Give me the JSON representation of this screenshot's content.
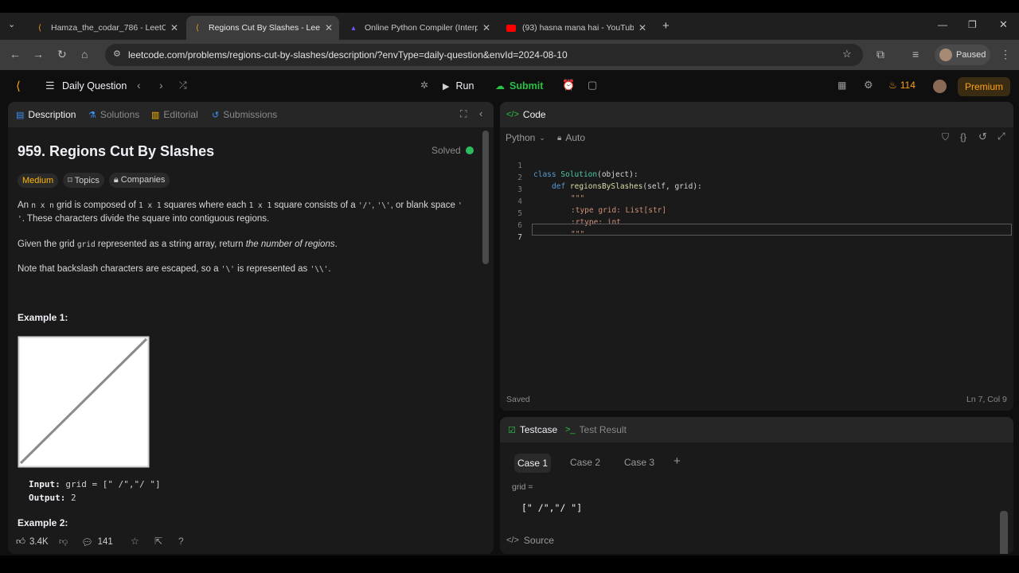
{
  "browser": {
    "tabs": [
      {
        "title": "Hamza_the_codar_786 - LeetCo",
        "icon": "leetcode-icon",
        "active": false
      },
      {
        "title": "Regions Cut By Slashes - LeetC",
        "icon": "leetcode-icon",
        "active": true
      },
      {
        "title": "Online Python Compiler (Interp",
        "icon": "programiz-icon",
        "active": false
      },
      {
        "title": "(93) hasna mana hai - YouTube",
        "icon": "youtube-icon",
        "active": false
      }
    ],
    "url": "leetcode.com/problems/regions-cut-by-slashes/description/?envType=daily-question&envId=2024-08-10",
    "profile_status": "Paused"
  },
  "nav": {
    "daily_question": "Daily Question",
    "run": "Run",
    "submit": "Submit",
    "streak": "114",
    "premium": "Premium"
  },
  "desc_tabs": {
    "description": "Description",
    "solutions": "Solutions",
    "editorial": "Editorial",
    "submissions": "Submissions"
  },
  "problem": {
    "title": "959. Regions Cut By Slashes",
    "status": "Solved",
    "difficulty": "Medium",
    "topics": "Topics",
    "companies": "Companies",
    "p1_a": "An",
    "p1_code1": "n x n",
    "p1_b": "grid is composed of",
    "p1_code2": "1 x 1",
    "p1_c": "squares where each",
    "p1_code3": "1 x 1",
    "p1_d": "square consists of a",
    "p1_code4": "'/'",
    "p1_sep1": ",",
    "p1_code5": "'\\'",
    "p1_e": ", or blank",
    "p1_f": "space",
    "p1_code6": "' '",
    "p1_g": ". These characters divide the square into contiguous regions.",
    "p2_a": "Given the grid",
    "p2_code": "grid",
    "p2_b": "represented as a string array, return",
    "p2_em": "the number of regions",
    "p2_c": ".",
    "p3_a": "Note that backslash characters are escaped, so a",
    "p3_code1": "'\\'",
    "p3_b": "is represented as",
    "p3_code2": "'\\\\'",
    "p3_c": ".",
    "example1": "Example 1:",
    "input_label": "Input:",
    "input_value": "grid = [\" /\",\"/ \"]",
    "output_label": "Output:",
    "output_value": "2",
    "example2": "Example 2:"
  },
  "footer": {
    "likes": "3.4K",
    "comments": "141"
  },
  "code": {
    "title": "Code",
    "language": "Python",
    "mode": "Auto",
    "lines": [
      "1",
      "2",
      "3",
      "4",
      "5",
      "6",
      "7"
    ],
    "l1_kw": "class",
    "l1_name": "Solution",
    "l1_rest": "(object):",
    "l2_kw": "def",
    "l2_name": "regionsBySlashes",
    "l2_rest": "(self, grid):",
    "l3": "\"\"\"",
    "l4": ":type grid: List[str]",
    "l5": ":rtype: int",
    "l6": "\"\"\"",
    "saved": "Saved",
    "cursor": "Ln 7, Col 9"
  },
  "testcase": {
    "tab": "Testcase",
    "result_tab": "Test Result",
    "cases": [
      "Case 1",
      "Case 2",
      "Case 3"
    ],
    "add": "+",
    "param": "grid =",
    "value": "[\" /\",\"/ \"]",
    "source": "Source"
  },
  "colors": {
    "accent_orange": "#ffa116",
    "easy_green": "#2cbb5d",
    "medium": "#ffb800",
    "submit_green": "#28c244"
  }
}
